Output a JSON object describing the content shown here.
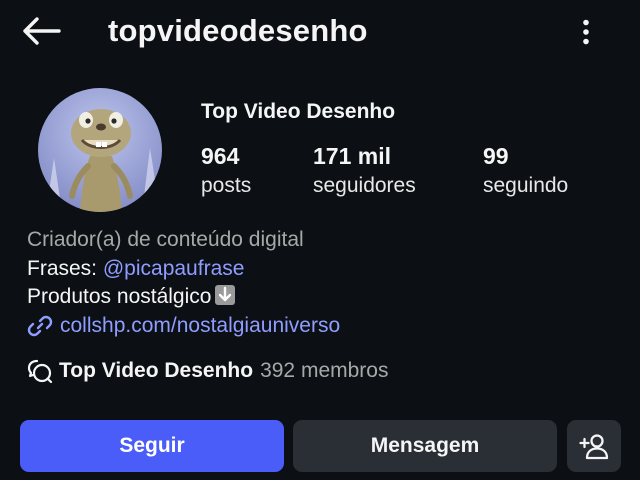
{
  "header": {
    "username": "topvideodesenho",
    "back_icon": "arrow-left-icon",
    "more_icon": "more-vertical-icon"
  },
  "profile": {
    "display_name": "Top Video Desenho",
    "avatar": "profile-avatar-cartoon-sloth",
    "stats": [
      {
        "value": "964",
        "label": "posts"
      },
      {
        "value": "171 mil",
        "label": "seguidores"
      },
      {
        "value": "99",
        "label": "seguindo"
      }
    ]
  },
  "bio": {
    "category": "Criador(a) de conteúdo digital",
    "frases_label": "Frases:",
    "frases_mention": "@picapaufrase",
    "line3": "Produtos nostálgico",
    "line3_emoji": "down-arrow-emoji",
    "link": "collshp.com/nostalgiauniverso"
  },
  "channel": {
    "name": "Top Video Desenho",
    "members": "392 membros",
    "icon": "broadcast-chat-icon"
  },
  "actions": {
    "follow_label": "Seguir",
    "message_label": "Mensagem",
    "suggest_icon": "add-person-icon"
  },
  "colors": {
    "background": "#0c1014",
    "accent": "#4a5df9",
    "link": "#8e9dff",
    "secondary_button": "#2a2f36",
    "muted_text": "#a8a8a8"
  }
}
